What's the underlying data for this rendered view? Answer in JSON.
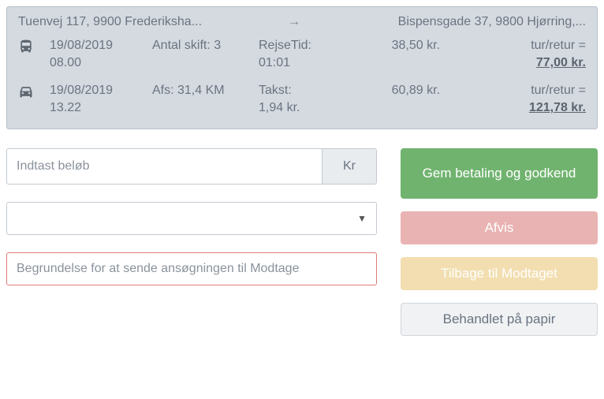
{
  "trip": {
    "from": "Tuenvej 117, 9900 Frederiksha...",
    "to": "Bispensgade 37, 9800 Hjørring,...",
    "rows": [
      {
        "date": "19/08/2019",
        "time": "08.00",
        "shift_label": "Antal skift: 3",
        "travel_label": "RejseTid:",
        "travel_value": "01:01",
        "cost": "38,50 kr.",
        "total_label": "tur/retur =",
        "total_value": "77,00 kr."
      },
      {
        "date": "19/08/2019",
        "time": "13.22",
        "shift_label": "Afs: 31,4 KM",
        "travel_label": "Takst:",
        "travel_value": "1,94 kr.",
        "cost": "60,89 kr.",
        "total_label": "tur/retur =",
        "total_value": "121,78 kr."
      }
    ]
  },
  "inputs": {
    "amount_placeholder": "Indtast beløb",
    "currency_suffix": "Kr",
    "reason_placeholder": "Begrundelse for at sende ansøgningen til Modtage"
  },
  "buttons": {
    "approve": "Gem betaling og godkend",
    "reject": "Afvis",
    "back_received": "Tilbage til Modtaget",
    "paper": "Behandlet på papir"
  }
}
